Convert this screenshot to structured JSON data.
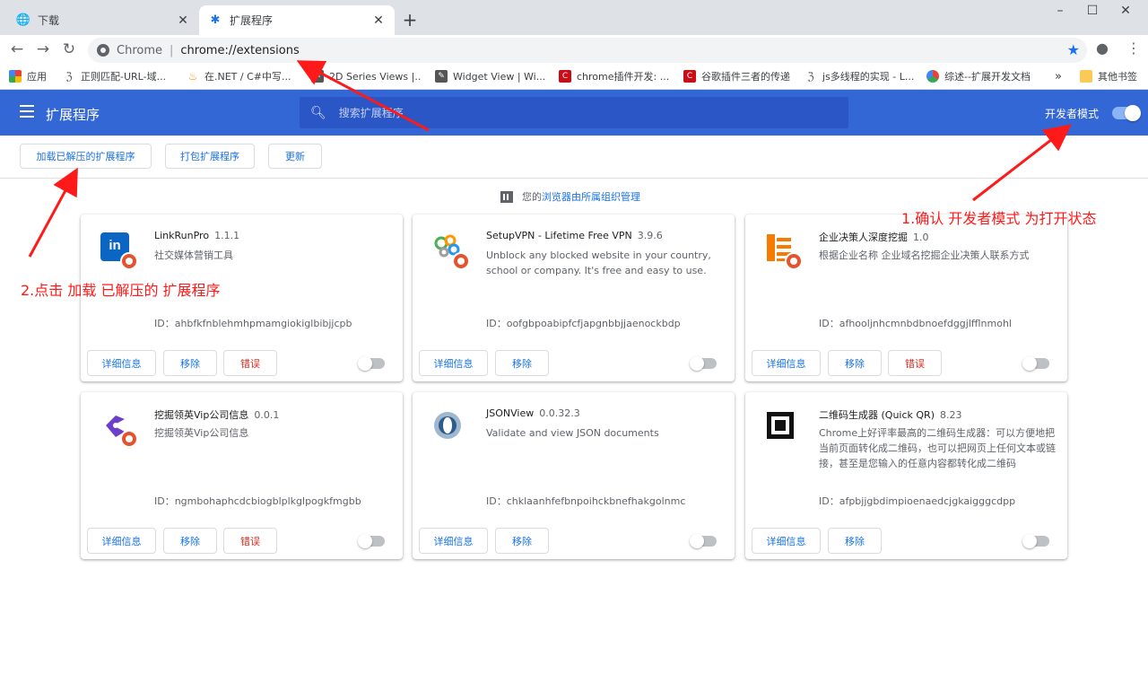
{
  "tabs": [
    {
      "label": "下载",
      "active": false
    },
    {
      "label": "扩展程序",
      "active": true
    }
  ],
  "window_controls": {
    "minimize": "–",
    "maximize": "☐",
    "close": "✕"
  },
  "address_bar": {
    "scheme_label": "Chrome",
    "url": "chrome://extensions"
  },
  "bookmarks": [
    {
      "label": "应用",
      "icon": "apps-grid-icon",
      "color": "#ea4335"
    },
    {
      "label": "正则匹配-URL-域...",
      "icon": "site-icon",
      "color": "#5f6368"
    },
    {
      "label": "在.NET / C#中写...",
      "icon": "java-icon",
      "color": "#f29111"
    },
    {
      "label": "2D Series Views |...",
      "icon": "pencil-icon",
      "color": "#555555"
    },
    {
      "label": "Widget View | Wi...",
      "icon": "pencil-icon",
      "color": "#555555"
    },
    {
      "label": "chrome插件开发: ...",
      "icon": "csdn-icon",
      "color": "#ca0c16"
    },
    {
      "label": "谷歌插件三者的传递",
      "icon": "csdn-icon",
      "color": "#ca0c16"
    },
    {
      "label": "js多线程的实现 - L...",
      "icon": "site-icon",
      "color": "#5f6368"
    },
    {
      "label": "综述--扩展开发文档",
      "icon": "pinwheel-icon",
      "color": "#34a853"
    },
    {
      "label": "»",
      "icon": "",
      "color": ""
    },
    {
      "label": "其他书签",
      "icon": "folder-icon",
      "color": "#f9cb55"
    }
  ],
  "header": {
    "title": "扩展程序",
    "search_placeholder": "搜索扩展程序",
    "dev_mode_label": "开发者模式",
    "dev_mode_on": true,
    "bar_color": "#3367d6"
  },
  "actions": {
    "load_unpacked": "加载已解压的扩展程序",
    "pack": "打包扩展程序",
    "update": "更新"
  },
  "managed_notice": {
    "prefix": "您的",
    "link": "浏览器由所属组织管理"
  },
  "card_buttons": {
    "details": "详细信息",
    "remove": "移除",
    "errors": "错误"
  },
  "extensions": [
    {
      "name": "LinkRunPro",
      "version": "1.1.1",
      "description": "社交媒体营销工具",
      "id": "ID：ahbfkfnblehmhpmamgiokiglbibjjcpb",
      "has_errors": true,
      "enabled": false,
      "icon": "linkedin-icon"
    },
    {
      "name": "SetupVPN - Lifetime Free VPN",
      "version": "3.9.6",
      "description": "Unblock any blocked website in your country, school or company. It's free and easy to use.",
      "id": "ID：oofgbpoabipfcfjapgnbbjjaenockbdp",
      "has_errors": false,
      "enabled": false,
      "icon": "vpn-icon"
    },
    {
      "name": "企业决策人深度挖掘",
      "version": "1.0",
      "description": "根据企业名称 企业域名挖掘企业决策人联系方式",
      "id": "ID：afhooljnhcmnbdbnoefdggjlfflnmohl",
      "has_errors": true,
      "enabled": false,
      "icon": "building-icon"
    },
    {
      "name": "挖掘领英Vip公司信息",
      "version": "0.0.1",
      "description": "挖掘领英Vip公司信息",
      "id": "ID：ngmbohaphcdcbiogblplkglpogkfmgbb",
      "has_errors": true,
      "enabled": false,
      "icon": "e-logo-icon"
    },
    {
      "name": "JSONView",
      "version": "0.0.32.3",
      "description": "Validate and view JSON documents",
      "id": "ID：chklaanhfefbnpoihckbnefhakgolnmc",
      "has_errors": false,
      "enabled": false,
      "icon": "json-icon"
    },
    {
      "name": "二维码生成器 (Quick QR)",
      "version": "8.23",
      "description": "Chrome上好评率最高的二维码生成器：可以方便地把当前页面转化成二维码，也可以把网页上任何文本或链接，甚至是您输入的任意内容都转化成二维码",
      "id": "ID：afpbjjgbdimpioenaedcjgkaigggcdpp",
      "has_errors": false,
      "enabled": false,
      "icon": "qr-icon"
    }
  ],
  "annotations": {
    "step1": "1.确认 开发者模式 为打开状态",
    "step2": "2.点击 加载 已解压的 扩展程序",
    "color": "#ff1a1a"
  }
}
